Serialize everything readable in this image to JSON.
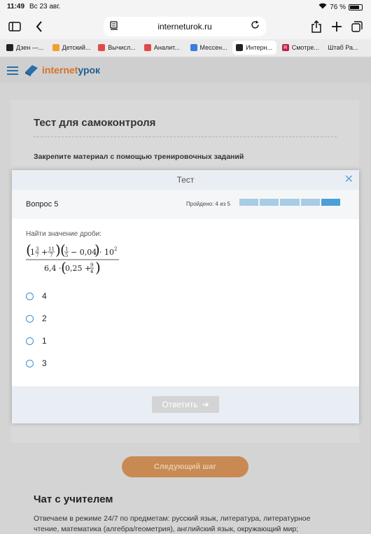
{
  "status": {
    "time": "11:49",
    "date": "Вс 23 авг.",
    "battery": "76 %"
  },
  "browser": {
    "url": "interneturok.ru",
    "tabs": [
      {
        "label": "Дзен —...",
        "color": "#222222",
        "glyph": ""
      },
      {
        "label": "Детский...",
        "color": "#f0a030",
        "glyph": ""
      },
      {
        "label": "Вычисл...",
        "color": "#e24a4a",
        "glyph": ""
      },
      {
        "label": "Аналит...",
        "color": "#e24a4a",
        "glyph": ""
      },
      {
        "label": "Мессен...",
        "color": "#3a7be0",
        "glyph": ""
      },
      {
        "label": "Интерн...",
        "color": "#222222",
        "glyph": ""
      },
      {
        "label": "Смотре...",
        "color": "#c0224a",
        "glyph": "R"
      },
      {
        "label": "Штаб Ра...",
        "color": "",
        "glyph": ""
      }
    ],
    "active_tab": 5
  },
  "site": {
    "logo_part1": "internet",
    "logo_part2": "урок"
  },
  "page": {
    "title": "Тест для самоконтроля",
    "subtitle": "Закрепите материал с помощью тренировочных заданий",
    "next_button": "Следующий шаг",
    "chat_title": "Чат с учителем",
    "chat_text": "Отвечаем в режиме 24/7 по предметам: русский язык, литература, литературное чтение, математика (алгебра/геометрия), английский язык, окружающий мир;"
  },
  "modal": {
    "title": "Тест",
    "question_label": "Вопрос 5",
    "passed": "Пройдено: 4 из 5",
    "progress_total": 5,
    "progress_current": 5,
    "question_text": "Найти значение дроби:",
    "formula": {
      "num_whole": "1",
      "num_f1_n": "3",
      "num_f1_d": "7",
      "plus": "+",
      "num_f2_n": "11",
      "num_f2_d": "7",
      "num_f3_n": "1",
      "num_f3_d": "5",
      "minus": "− 0,04",
      "times_pow": "· 10",
      "pow": "2",
      "den_left": "6,4 ·",
      "den_val": "0,25 +",
      "den_f_n": "9",
      "den_f_d": "4"
    },
    "answers": [
      "4",
      "2",
      "1",
      "3"
    ],
    "submit_label": "Ответить"
  }
}
